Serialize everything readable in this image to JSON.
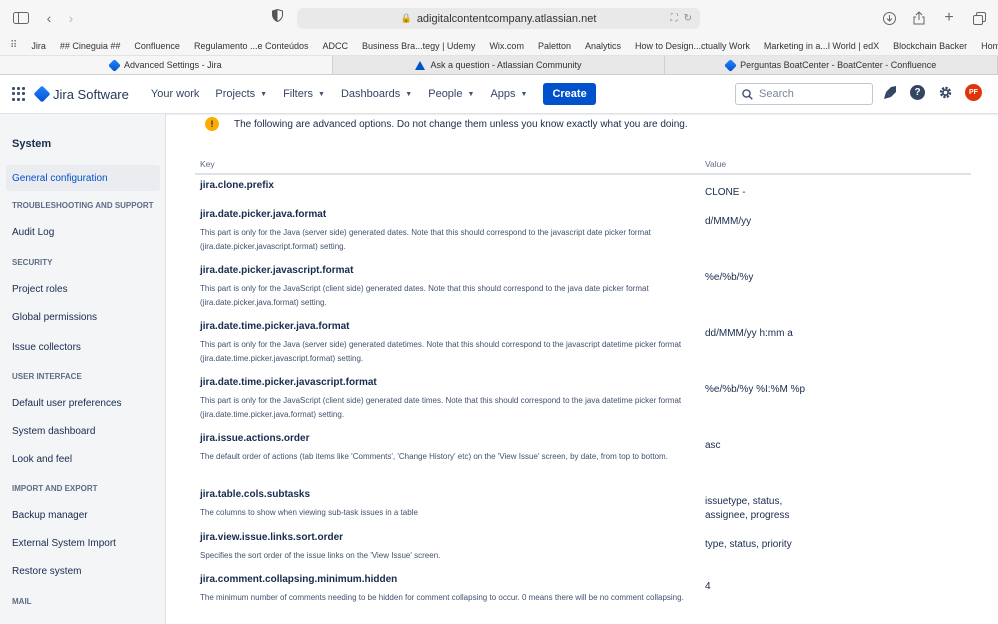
{
  "browser": {
    "url": "adigitalcontentcompany.atlassian.net",
    "bookmarks": [
      "Jira",
      "## Cineguia ##",
      "Confluence",
      "Regulamento ...e Conteúdos",
      "ADCC",
      "Business Bra...tegy | Udemy",
      "Wix.com",
      "Paletton",
      "Analytics",
      "How to Design...ctually Work",
      "Marketing in a...l World | edX",
      "Blockchain Backer",
      "Home - El Ranchito"
    ],
    "tabs": [
      {
        "label": "Advanced Settings - Jira"
      },
      {
        "label": "Ask a question - Atlassian Community"
      },
      {
        "label": "Perguntas BoatCenter - BoatCenter - Confluence"
      }
    ]
  },
  "header": {
    "logo_text": "Jira Software",
    "nav": [
      "Your work",
      "Projects",
      "Filters",
      "Dashboards",
      "People",
      "Apps"
    ],
    "create_label": "Create",
    "search_placeholder": "Search",
    "avatar_initials": "PF"
  },
  "sidebar": {
    "title": "System",
    "active_item": "General configuration",
    "sections": [
      {
        "heading": "TROUBLESHOOTING AND SUPPORT",
        "items": [
          "Audit Log"
        ]
      },
      {
        "heading": "SECURITY",
        "items": [
          "Project roles",
          "Global permissions",
          "Issue collectors"
        ]
      },
      {
        "heading": "USER INTERFACE",
        "items": [
          "Default user preferences",
          "System dashboard",
          "Look and feel"
        ]
      },
      {
        "heading": "IMPORT AND EXPORT",
        "items": [
          "Backup manager",
          "External System Import",
          "Restore system"
        ]
      },
      {
        "heading": "MAIL",
        "items": []
      }
    ]
  },
  "main": {
    "warning": "The following are advanced options. Do not change them unless you know exactly what you are doing.",
    "columns": {
      "key": "Key",
      "value": "Value"
    },
    "rows": [
      {
        "key": "jira.clone.prefix",
        "desc": "",
        "value": "CLONE -"
      },
      {
        "key": "jira.date.picker.java.format",
        "desc": "This part is only for the Java (server side) generated dates. Note that this should correspond to the javascript date picker format (jira.date.picker.javascript.format) setting.",
        "value": "d/MMM/yy"
      },
      {
        "key": "jira.date.picker.javascript.format",
        "desc": "This part is only for the JavaScript (client side) generated dates. Note that this should correspond to the java date picker format (jira.date.picker.java.format) setting.",
        "value": "%e/%b/%y"
      },
      {
        "key": "jira.date.time.picker.java.format",
        "desc": "This part is only for the Java (server side) generated datetimes. Note that this should correspond to the javascript datetime picker format (jira.date.time.picker.javascript.format) setting.",
        "value": "dd/MMM/yy h:mm a"
      },
      {
        "key": "jira.date.time.picker.javascript.format",
        "desc": "This part is only for the JavaScript (client side) generated date times. Note that this should correspond to the java datetime picker format (jira.date.time.picker.java.format) setting.",
        "value": "%e/%b/%y %I:%M %p"
      },
      {
        "key": "jira.issue.actions.order",
        "desc": "The default order of actions (tab items like 'Comments', 'Change History' etc) on the 'View Issue' screen, by date, from top to bottom.",
        "value": "asc"
      },
      {
        "key": "jira.table.cols.subtasks",
        "desc": "The columns to show when viewing sub-task issues in a table",
        "value": "issuetype, status, assignee, progress"
      },
      {
        "key": "jira.view.issue.links.sort.order",
        "desc": "Specifies the sort order of the issue links on the 'View Issue' screen.",
        "value": "type, status, priority"
      },
      {
        "key": "jira.comment.collapsing.minimum.hidden",
        "desc": "The minimum number of comments needing to be hidden for comment collapsing to occur. 0 means there will be no comment collapsing.",
        "value": "4"
      }
    ]
  }
}
